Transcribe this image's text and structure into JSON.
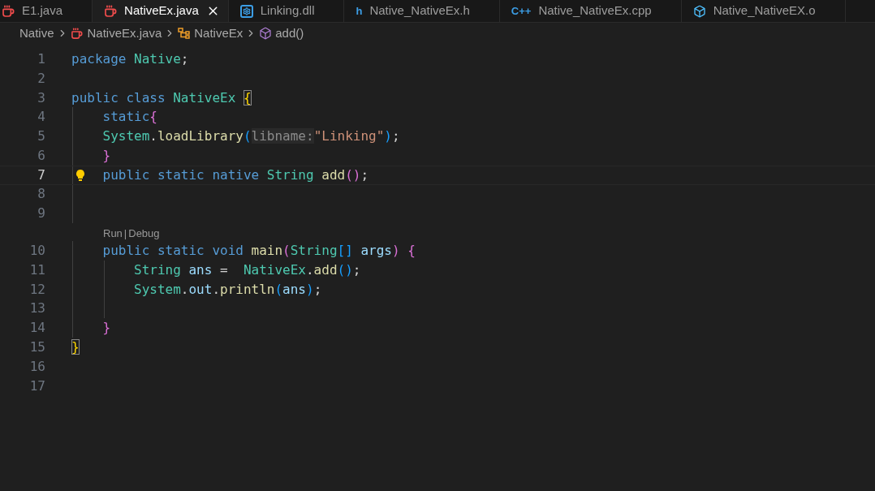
{
  "tabs": [
    {
      "label": "E1.java",
      "kind": "java",
      "selected": false
    },
    {
      "label": "NativeEx.java",
      "kind": "java",
      "selected": true
    },
    {
      "label": "Linking.dll",
      "kind": "dll",
      "selected": false
    },
    {
      "label": "Native_NativeEx.h",
      "kind": "text",
      "icon_text": "h",
      "selected": false
    },
    {
      "label": "Native_NativeEx.cpp",
      "kind": "text",
      "icon_text": "C++",
      "selected": false
    },
    {
      "label": "Native_NativeEX.o",
      "kind": "cube",
      "selected": false
    }
  ],
  "breadcrumbs": [
    {
      "label": "Native",
      "kind": "folder"
    },
    {
      "label": "NativeEx.java",
      "kind": "java"
    },
    {
      "label": "NativeEx",
      "kind": "class"
    },
    {
      "label": "add()",
      "kind": "method"
    }
  ],
  "lines": [
    {
      "number": "1",
      "current": false,
      "tokens": [
        {
          "kind": "keyword",
          "text": "package "
        },
        {
          "kind": "type",
          "text": "Native"
        },
        {
          "kind": "plain",
          "text": ";"
        }
      ]
    },
    {
      "number": "2",
      "current": false
    },
    {
      "number": "3",
      "current": false,
      "tokens": [
        {
          "kind": "keyword",
          "text": "public class "
        },
        {
          "kind": "type",
          "text": "NativeEx "
        },
        {
          "kind": "match",
          "text": "{"
        }
      ]
    },
    {
      "number": "4",
      "current": false,
      "tokens": [
        {
          "kind": "keyword",
          "text": "    static"
        },
        {
          "kind": "bracket2",
          "text": "{"
        }
      ]
    },
    {
      "number": "5",
      "current": false,
      "tokens": [
        {
          "kind": "type",
          "text": "    System"
        },
        {
          "kind": "plain",
          "text": "."
        },
        {
          "kind": "func",
          "text": "loadLibrary"
        },
        {
          "kind": "bracket3",
          "text": "("
        },
        {
          "kind": "hint",
          "text": "libname:"
        },
        {
          "kind": "string",
          "text": "\"Linking\""
        },
        {
          "kind": "bracket3",
          "text": ")"
        },
        {
          "kind": "plain",
          "text": ";"
        }
      ]
    },
    {
      "number": "6",
      "current": false,
      "tokens": [
        {
          "kind": "bracket2",
          "text": "    }"
        }
      ]
    },
    {
      "number": "7",
      "current": true,
      "tokens": [
        {
          "kind": "keyword",
          "text": "    public static native "
        },
        {
          "kind": "type",
          "text": "String "
        },
        {
          "kind": "func",
          "text": "add"
        },
        {
          "kind": "bracket2",
          "text": "()"
        },
        {
          "kind": "plain",
          "text": ";"
        }
      ]
    },
    {
      "number": "8",
      "current": false
    },
    {
      "number": "9",
      "current": false
    },
    {
      "number": "10",
      "current": false,
      "codelens": {
        "items": [
          "Run",
          "Debug"
        ],
        "separator": "|"
      },
      "tokens": [
        {
          "kind": "keyword",
          "text": "    public static void "
        },
        {
          "kind": "func",
          "text": "main"
        },
        {
          "kind": "bracket2",
          "text": "("
        },
        {
          "kind": "type",
          "text": "String"
        },
        {
          "kind": "bracket3",
          "text": "[] "
        },
        {
          "kind": "variable",
          "text": "args"
        },
        {
          "kind": "bracket2",
          "text": ") {"
        }
      ]
    },
    {
      "number": "11",
      "current": false,
      "tokens": [
        {
          "kind": "type",
          "text": "        String "
        },
        {
          "kind": "variable",
          "text": "ans"
        },
        {
          "kind": "plain",
          "text": " =  "
        },
        {
          "kind": "type",
          "text": "NativeEx"
        },
        {
          "kind": "plain",
          "text": "."
        },
        {
          "kind": "func",
          "text": "add"
        },
        {
          "kind": "bracket3",
          "text": "()"
        },
        {
          "kind": "plain",
          "text": ";"
        }
      ]
    },
    {
      "number": "12",
      "current": false,
      "tokens": [
        {
          "kind": "type",
          "text": "        System"
        },
        {
          "kind": "plain",
          "text": "."
        },
        {
          "kind": "variable",
          "text": "out"
        },
        {
          "kind": "plain",
          "text": "."
        },
        {
          "kind": "func",
          "text": "println"
        },
        {
          "kind": "bracket3",
          "text": "("
        },
        {
          "kind": "variable",
          "text": "ans"
        },
        {
          "kind": "bracket3",
          "text": ")"
        },
        {
          "kind": "plain",
          "text": ";"
        }
      ]
    },
    {
      "number": "13",
      "current": false
    },
    {
      "number": "14",
      "current": false,
      "tokens": [
        {
          "kind": "bracket2",
          "text": "    }"
        }
      ]
    },
    {
      "number": "15",
      "current": false,
      "tokens": [
        {
          "kind": "match",
          "text": "}"
        }
      ]
    },
    {
      "number": "16",
      "current": false
    },
    {
      "number": "17",
      "current": false
    }
  ]
}
